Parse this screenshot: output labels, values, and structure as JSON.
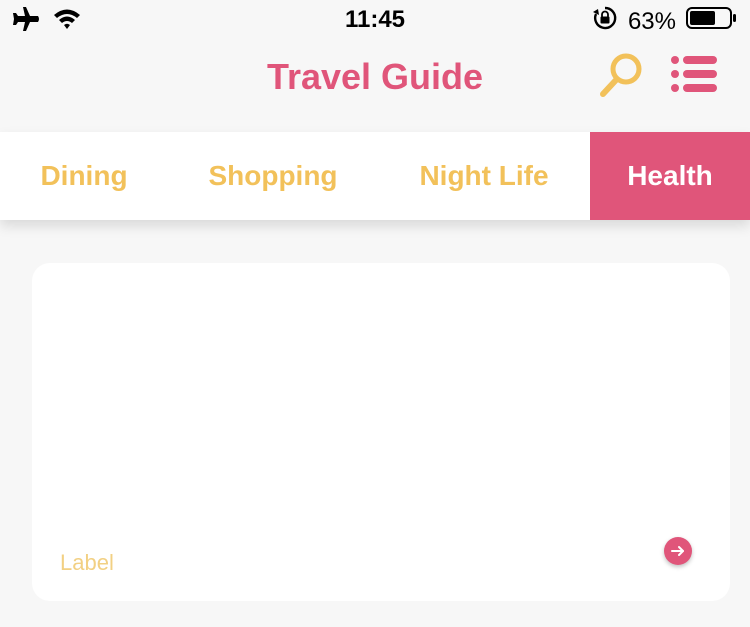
{
  "status_bar": {
    "time": "11:45",
    "battery_percent": "63%",
    "icons": [
      "airplane-icon",
      "wifi-icon",
      "orientation-lock-icon",
      "battery-icon"
    ]
  },
  "header": {
    "title": "Travel Guide",
    "icons": [
      "search-icon",
      "menu-list-icon"
    ]
  },
  "tabs": [
    {
      "label": "Dining",
      "active": false
    },
    {
      "label": "Shopping",
      "active": false
    },
    {
      "label": "Night Life",
      "active": false
    },
    {
      "label": "Health",
      "active": true
    }
  ],
  "card": {
    "label": "Label",
    "action_icon": "arrow-right-icon"
  },
  "colors": {
    "accent_pink": "#e0557a",
    "accent_yellow": "#f2c15a",
    "background": "#f7f7f7"
  }
}
